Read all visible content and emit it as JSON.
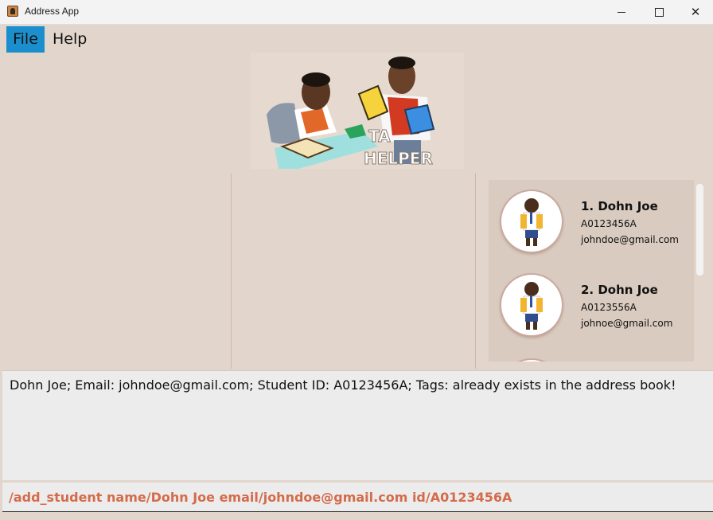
{
  "window": {
    "title": "Address App",
    "controls": {
      "minimize_icon": "minimize-icon",
      "maximize_icon": "maximize-icon",
      "close_icon": "close-icon"
    }
  },
  "menu": {
    "items": [
      {
        "label": "File",
        "active": true
      },
      {
        "label": "Help",
        "active": false
      }
    ],
    "active_color": "#1b8fcd"
  },
  "banner": {
    "line1": "TA",
    "line2": "HELPER"
  },
  "student_list": {
    "cards": [
      {
        "index_name": "1.  Dohn Joe",
        "student_id": "A0123456A",
        "email": "johndoe@gmail.com",
        "avatar_icon": "student-avatar-icon"
      },
      {
        "index_name": "2.  Dohn Joe",
        "student_id": "A0123556A",
        "email": "johnoe@gmail.com",
        "avatar_icon": "student-avatar-icon"
      }
    ]
  },
  "result_display": {
    "message": "Dohn Joe; Email: johndoe@gmail.com; Student ID: A0123456A; Tags:  already exists in the address book!"
  },
  "command_box": {
    "value": "/add_student name/Dohn Joe email/johndoe@gmail.com id/A0123456A",
    "text_color": "#d46b4a"
  },
  "theme": {
    "background": "#e2d6cc",
    "list_background": "#d9cbbf"
  }
}
